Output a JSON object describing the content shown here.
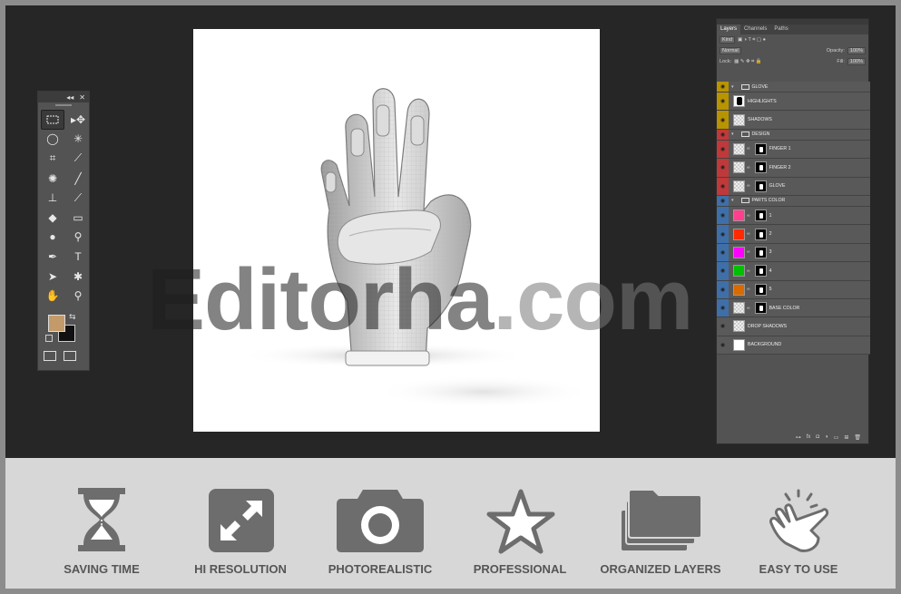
{
  "watermark": {
    "main": "Editorha",
    "dot": ".",
    "suffix": "com"
  },
  "tools_panel": {
    "collapse_glyph": "◂◂",
    "close_glyph": "✕",
    "foreground_color": "#c39b6a",
    "background_color": "#111111",
    "tools": [
      "marquee-icon",
      "move-icon",
      "lasso-icon",
      "magic-wand-icon",
      "crop-icon",
      "eyedropper-icon",
      "spot-heal-icon",
      "brush-icon",
      "stamp-icon",
      "history-brush-icon",
      "eraser-icon",
      "gradient-icon",
      "blur-icon",
      "dodge-icon",
      "pen-icon",
      "type-icon",
      "path-select-icon",
      "shape-icon",
      "hand-icon",
      "zoom-icon"
    ]
  },
  "layers_panel": {
    "tabs": [
      "Layers",
      "Channels",
      "Paths"
    ],
    "filter_kind": "Kind",
    "blend_mode": "Normal",
    "opacity_label": "Opacity:",
    "opacity_value": "100%",
    "lock_label": "Lock:",
    "fill_label": "Fill:",
    "fill_value": "100%",
    "layers": [
      {
        "name": "GLOVE",
        "kind": "group",
        "color": "#b89400"
      },
      {
        "name": "HIGHLIGHTS",
        "kind": "layer",
        "color": "#b89400"
      },
      {
        "name": "SHADOWS",
        "kind": "layer",
        "color": "#b89400"
      },
      {
        "name": "DESIGN",
        "kind": "group",
        "color": "#c0393a"
      },
      {
        "name": "FINGER 1",
        "kind": "layer",
        "color": "#c0393a"
      },
      {
        "name": "FINGER 2",
        "kind": "layer",
        "color": "#c0393a"
      },
      {
        "name": "GLOVE",
        "kind": "layer",
        "color": "#c0393a"
      },
      {
        "name": "PARTS COLOR",
        "kind": "group",
        "color": "#3f6fa8"
      },
      {
        "name": "1",
        "kind": "layer",
        "color": "#3f6fa8",
        "swatch": "#ff3f8e"
      },
      {
        "name": "2",
        "kind": "layer",
        "color": "#3f6fa8",
        "swatch": "#ff2a00"
      },
      {
        "name": "3",
        "kind": "layer",
        "color": "#3f6fa8",
        "swatch": "#ff00ff"
      },
      {
        "name": "4",
        "kind": "layer",
        "color": "#3f6fa8",
        "swatch": "#00c000"
      },
      {
        "name": "5",
        "kind": "layer",
        "color": "#3f6fa8",
        "swatch": "#d86a00"
      },
      {
        "name": "BASE COLOR",
        "kind": "layer",
        "color": "#3f6fa8"
      },
      {
        "name": "DROP SHADOWS",
        "kind": "layer",
        "color": "#5a5a5a"
      },
      {
        "name": "BACKGROUND",
        "kind": "layer",
        "color": "#5a5a5a"
      }
    ]
  },
  "features": [
    {
      "label": "SAVING TIME",
      "icon": "hourglass-icon"
    },
    {
      "label": "HI RESOLUTION",
      "icon": "expand-icon"
    },
    {
      "label": "PHOTOREALISTIC",
      "icon": "camera-icon"
    },
    {
      "label": "PROFESSIONAL",
      "icon": "star-icon"
    },
    {
      "label": "ORGANIZED LAYERS",
      "icon": "folders-icon"
    },
    {
      "label": "EASY TO USE",
      "icon": "tap-hand-icon"
    }
  ],
  "colors": {
    "icon": "#6d6d6d",
    "band": "#d7d7d7",
    "workspace": "#262626"
  }
}
